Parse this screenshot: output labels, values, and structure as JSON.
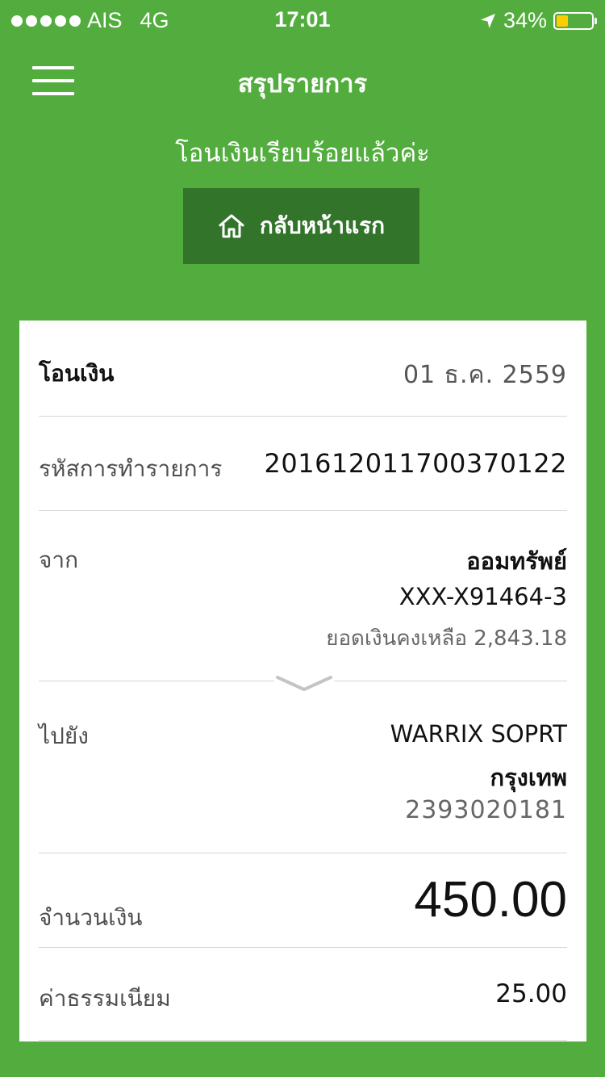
{
  "status_bar": {
    "carrier": "AIS",
    "network": "4G",
    "time": "17:01",
    "battery": "34%",
    "battery_level": 0.34,
    "battery_color": "#ffcc00"
  },
  "header": {
    "title": "สรุปรายการ",
    "menu_icon": "hamburger-menu-icon",
    "success_message": "โอนเงินเรียบร้อยแล้วค่ะ",
    "home_button_label": "กลับหน้าแรก",
    "home_icon": "home-icon"
  },
  "colors": {
    "background": "#53ad3e",
    "button": "#32742a",
    "card": "#ffffff"
  },
  "transaction": {
    "type": "โอนเงิน",
    "date": "01 ธ.ค. 2559",
    "ref_label": "รหัสการทำรายการ",
    "ref_value": "201612011700370122",
    "from_label": "จาก",
    "from_account_type": "ออมทรัพย์",
    "from_account_number": "XXX-X91464-3",
    "from_balance": "ยอดเงินคงเหลือ 2,843.18",
    "to_label": "ไปยัง",
    "to_name": "WARRIX SOPRT",
    "to_bank": "กรุงเทพ",
    "to_account_number": "2393020181",
    "amount_label": "จำนวนเงิน",
    "amount_value": "450.00",
    "fee_label": "ค่าธรรมเนียม",
    "fee_value": "25.00"
  }
}
